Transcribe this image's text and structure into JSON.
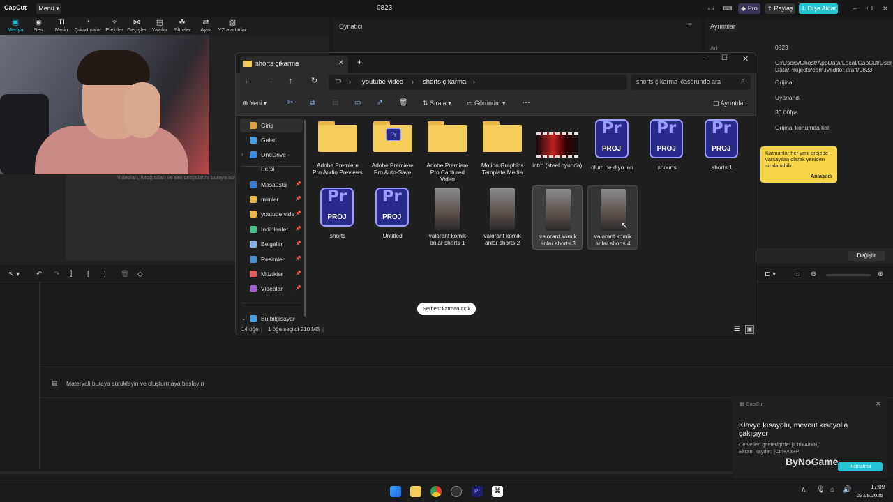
{
  "capcut": {
    "logo": "CapCut",
    "menu_label": "Menü",
    "project_title": "0823",
    "pro_label": "Pro",
    "share_label": "Paylaş",
    "export_label": "Dışa Aktar",
    "tools": [
      "Medya",
      "Ses",
      "Metin",
      "Çıkartmalar",
      "Efektler",
      "Geçişler",
      "Yazılar",
      "Filtreler",
      "Ayar",
      "YZ avatarlar"
    ],
    "player_title": "Oynatıcı",
    "media_hint": "Videoları, fotoğrafları ve ses dosyalarını buraya sürükleyin",
    "details_title": "Ayrıntılar",
    "details": {
      "label_name": "Ad:",
      "name": "0823",
      "path": "C:/Users/Ghost/AppData/Local/CapCut/User Data/Projects/com.lveditor.draft/0823",
      "ratio": "Orijinal",
      "resolution": "Uyarlandı",
      "fps": "30.00fps",
      "import": "Orijinal konumda kal",
      "change_button": "Değiştir"
    },
    "tooltip_text": "Katmanlar her yeni projede varsayılan olarak yeniden sıralanabilir.",
    "tooltip_button": "Anlaşıldı",
    "timeline_hint": "Materyali buraya sürükleyin ve oluşturmaya başlayın",
    "notification": {
      "app": "CapCut",
      "title": "Klavye kısayolu, mevcut kısayolla çakışıyor",
      "line1": "Cetvelleri göster/gizle: [Ctrl+Alt+R]",
      "line2": "Ekranı kaydet: [Ctrl+Alt+P]",
      "badge": "İnstrıatma"
    },
    "watermark": "ByNoGame"
  },
  "explorer": {
    "tab_title": "shorts çıkarma",
    "breadcrumb": [
      "youtube video",
      "shorts çıkarma"
    ],
    "search_placeholder": "shorts çıkarma klasöründe ara",
    "commands": {
      "new": "Yeni",
      "sort": "Sırala",
      "view": "Görünüm",
      "details": "Ayrıntılar"
    },
    "sidebar": [
      {
        "label": "Giriş",
        "color": "#e0a040"
      },
      {
        "label": "Galeri",
        "color": "#4aa0e0"
      },
      {
        "label": "OneDrive - Persi",
        "color": "#3a8ae0"
      },
      {
        "label": "Masaüstü",
        "color": "#3a7ad0"
      },
      {
        "label": "mimler",
        "color": "#e8b84a"
      },
      {
        "label": "youtube vide",
        "color": "#e8b84a"
      },
      {
        "label": "İndirilenler",
        "color": "#4ac08a"
      },
      {
        "label": "Belgeler",
        "color": "#8ab0e0"
      },
      {
        "label": "Resimler",
        "color": "#4a90d0"
      },
      {
        "label": "Müzikler",
        "color": "#e06060"
      },
      {
        "label": "Videolar",
        "color": "#a060d0"
      },
      {
        "label": "Bu bilgisayar",
        "color": "#4aa0e0"
      }
    ],
    "files": [
      {
        "name": "Adobe Premiere Pro Audio Previews",
        "kind": "folder"
      },
      {
        "name": "Adobe Premiere Pro Auto-Save",
        "kind": "folder-pr"
      },
      {
        "name": "Adobe Premiere Pro Captured Video",
        "kind": "folder"
      },
      {
        "name": "Motion Graphics Template Media",
        "kind": "folder"
      },
      {
        "name": "intro (steel oyunda)",
        "kind": "video"
      },
      {
        "name": "olum ne diyo lan",
        "kind": "proj"
      },
      {
        "name": "shourts",
        "kind": "proj"
      },
      {
        "name": "shorts 1",
        "kind": "proj"
      },
      {
        "name": "shorts",
        "kind": "proj"
      },
      {
        "name": "Untitled",
        "kind": "proj"
      },
      {
        "name": "valorant komik anlar shorts 1",
        "kind": "thumb"
      },
      {
        "name": "valorant komik anlar shorts 2",
        "kind": "thumb"
      },
      {
        "name": "valorant komik anlar shorts 3",
        "kind": "thumb-sel"
      },
      {
        "name": "valorant komik anlar shorts 4",
        "kind": "thumb-hover"
      }
    ],
    "pr_letters": "Pr",
    "proj_label": "PROJ",
    "status": {
      "count": "14 öğe",
      "selected": "1 öğe seçildi  210 MB"
    },
    "toast": "Serbest katman açık"
  },
  "taskbar": {
    "time": "17:09",
    "date": "23.08.2025"
  }
}
